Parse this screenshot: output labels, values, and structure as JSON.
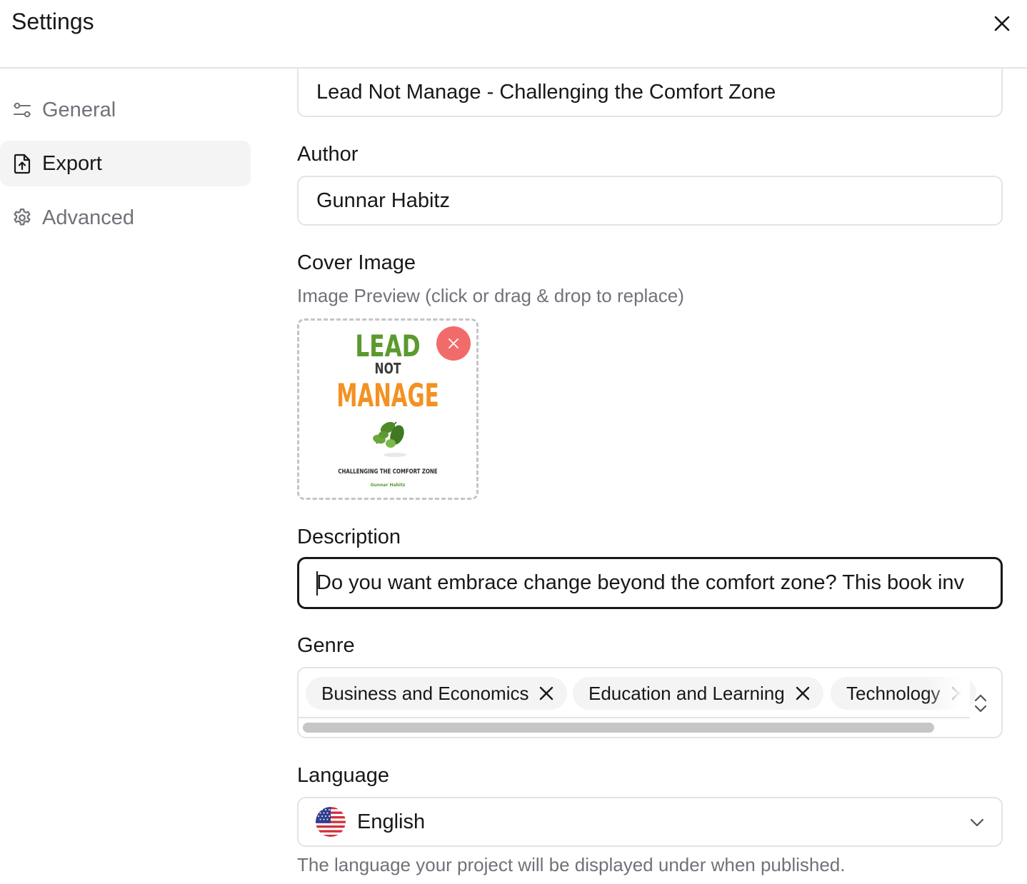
{
  "header": {
    "title": "Settings",
    "close_icon": "close-icon"
  },
  "sidebar": {
    "items": [
      {
        "label": "General",
        "icon": "sliders-icon",
        "active": false
      },
      {
        "label": "Export",
        "icon": "file-upload-icon",
        "active": true
      },
      {
        "label": "Advanced",
        "icon": "gear-icon",
        "active": false
      }
    ]
  },
  "form": {
    "title_value": "Lead Not Manage - Challenging the Comfort Zone",
    "author_label": "Author",
    "author_value": "Gunnar Habitz",
    "cover_label": "Cover Image",
    "cover_helper": "Image Preview (click or drag & drop to replace)",
    "cover": {
      "line1": "LEAD",
      "line2": "NOT",
      "line3": "MANAGE",
      "subtitle": "CHALLENGING THE COMFORT ZONE",
      "author": "Gunnar Habitz"
    },
    "description_label": "Description",
    "description_value": "Do you want embrace change beyond the comfort zone? This book inv",
    "genre_label": "Genre",
    "genres": [
      {
        "label": "Business and Economics"
      },
      {
        "label": "Education and Learning"
      },
      {
        "label": "Technology"
      }
    ],
    "language_label": "Language",
    "language_value": "English",
    "language_icon": "us-flag-icon",
    "language_helper": "The language your project will be displayed under when published."
  },
  "colors": {
    "accent_remove": "#f26b6b",
    "cover_green": "#5a9a2e",
    "cover_orange": "#f39122",
    "border": "#e4e4e7",
    "muted_text": "#71717a"
  }
}
